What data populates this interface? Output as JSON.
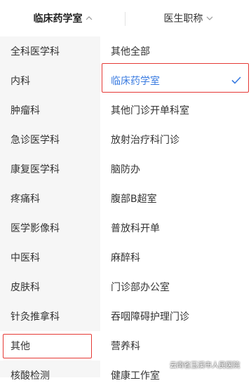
{
  "header": {
    "tab_department": "临床药学室",
    "tab_title": "医生职称"
  },
  "left_menu": [
    {
      "label": "全科医学科"
    },
    {
      "label": "内科"
    },
    {
      "label": "肿瘤科"
    },
    {
      "label": "急诊医学科"
    },
    {
      "label": "康复医学科"
    },
    {
      "label": "疼痛科"
    },
    {
      "label": "医学影像科"
    },
    {
      "label": "中医科"
    },
    {
      "label": "皮肤科"
    },
    {
      "label": "针灸推拿科"
    },
    {
      "label": "其他",
      "selected": true
    },
    {
      "label": "核酸检测"
    }
  ],
  "right_menu": [
    {
      "label": "其他全部"
    },
    {
      "label": "临床药学室",
      "selected": true
    },
    {
      "label": "其他门诊开单科室"
    },
    {
      "label": "放射治疗科门诊"
    },
    {
      "label": "脑防办"
    },
    {
      "label": "腹部B超室"
    },
    {
      "label": "普放科开单"
    },
    {
      "label": "麻醉科"
    },
    {
      "label": "门诊部办公室"
    },
    {
      "label": "吞咽障碍护理门诊"
    },
    {
      "label": "营养科"
    },
    {
      "label": "健康工作室"
    }
  ],
  "watermark": {
    "text": "云南省玉溪市人民医院"
  },
  "colors": {
    "accent": "#3a7be0",
    "highlight_box": "#e53935",
    "left_bg": "#f6f6f6",
    "left_selected_bg": "#ffffff"
  }
}
